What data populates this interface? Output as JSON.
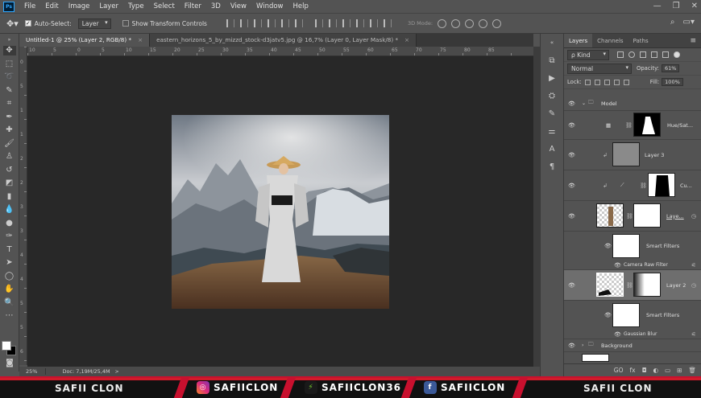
{
  "app": {
    "logo": "Ps"
  },
  "menu": [
    "File",
    "Edit",
    "Image",
    "Layer",
    "Type",
    "Select",
    "Filter",
    "3D",
    "View",
    "Window",
    "Help"
  ],
  "window_controls": [
    "—",
    "❐",
    "✕"
  ],
  "options": {
    "auto_select_label": "Auto-Select:",
    "auto_select_value": "Layer",
    "transform_label": "Show Transform Controls",
    "mode_3d": "3D Mode:"
  },
  "tabs": [
    {
      "label": "Untitled-1 @ 25% (Layer 2, RGB/8) *",
      "close": "×"
    },
    {
      "label": "eastern_horizons_5_by_mizzd_stock-d3jatv5.jpg @ 16,7% (Layer 0, Layer Mask/8) *",
      "close": "×"
    }
  ],
  "ruler_top_numbers": [
    "10",
    "5",
    "0",
    "5",
    "10",
    "15",
    "20",
    "25",
    "30",
    "35",
    "40",
    "45",
    "50",
    "55",
    "60",
    "65",
    "70",
    "75",
    "80",
    "85"
  ],
  "ruler_left_numbers": [
    "0",
    "5",
    "1",
    "1",
    "2",
    "2",
    "3",
    "3",
    "4",
    "4",
    "5",
    "5",
    "6"
  ],
  "status": {
    "zoom": "25%",
    "doc": "Doc: 7,19M/25,4M",
    "arrow": ">"
  },
  "layers_panel": {
    "tabs": [
      "Layers",
      "Channels",
      "Paths"
    ],
    "menu": "≡",
    "kind": "ρ Kind",
    "blend": "Normal",
    "opacity_label": "Opacity:",
    "opacity": "61%",
    "lock_label": "Lock:",
    "fill_label": "Fill:",
    "fill": "100%",
    "layers": [
      {
        "name": "Model",
        "type": "group"
      },
      {
        "name": "Hue/Sat...",
        "type": "adjustment"
      },
      {
        "name": "Layer 3",
        "type": "clipped"
      },
      {
        "name": "Cu...",
        "type": "adjustment"
      },
      {
        "name": "Laye...",
        "type": "smart"
      },
      {
        "name": "Smart Filters",
        "type": "filtermask"
      },
      {
        "name": "Camera Raw Filter",
        "type": "filter"
      },
      {
        "name": "Layer 2",
        "type": "smart"
      },
      {
        "name": "Smart Filters",
        "type": "filtermask"
      },
      {
        "name": "Gaussian Blur",
        "type": "filter"
      },
      {
        "name": "Background",
        "type": "group"
      }
    ],
    "bottom_icons": [
      "GO",
      "fx",
      "◘",
      "◐",
      "▭",
      "⊞",
      "🗑"
    ]
  },
  "banner": {
    "left": "SAFII CLON",
    "instagram": "SAFIICLON",
    "other": "SAFIICLON36",
    "facebook": "SAFIICLON",
    "right": "SAFII CLON",
    "colors": {
      "accent": "#c8102e",
      "bg": "#111111"
    }
  }
}
